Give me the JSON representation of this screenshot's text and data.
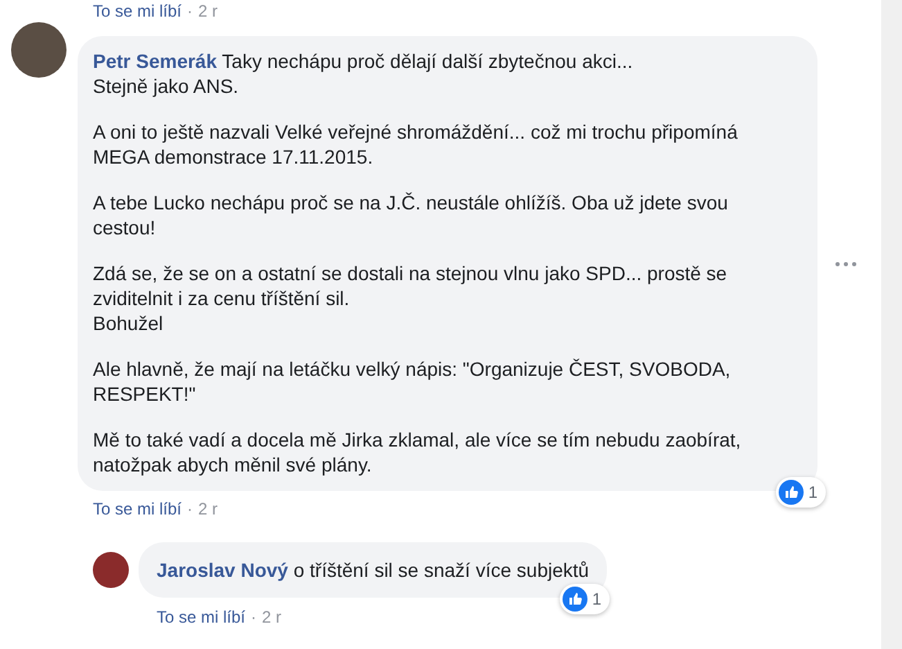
{
  "previous_actions": {
    "like": "To se mi líbí",
    "separator": "·",
    "time": "2 r"
  },
  "comment": {
    "author": "Petr Semerák",
    "paragraphs": [
      "Taky nechápu proč dělají další zbytečnou akci...\nStejně jako ANS.",
      "A oni to ještě nazvali Velké veřejné shromáždění... což mi trochu připomíná MEGA demonstrace 17.11.2015.",
      "A tebe Lucko nechápu proč se na J.Č. neustále ohlížíš. Oba už jdete svou cestou!",
      "Zdá se, že se on a ostatní se dostali na stejnou vlnu jako SPD... prostě se zviditelnit i za cenu tříštění sil.\nBohužel",
      "Ale hlavně, že mají na letáčku velký nápis: \"Organizuje ČEST, SVOBODA, RESPEKT!\"",
      "Mě to také vadí a docela mě Jirka zklamal, ale více se tím nebudu zaobírat, natožpak abych měnil své plány."
    ],
    "reaction_count": "1",
    "actions": {
      "like": "To se mi líbí",
      "separator": "·",
      "time": "2 r"
    },
    "reply": {
      "author": "Jaroslav Nový",
      "paragraphs": [
        "o tříštění sil se snaží více subjektů"
      ],
      "reaction_count": "1",
      "actions": {
        "like": "To se mi líbí",
        "separator": "·",
        "time": "2 r"
      }
    }
  }
}
